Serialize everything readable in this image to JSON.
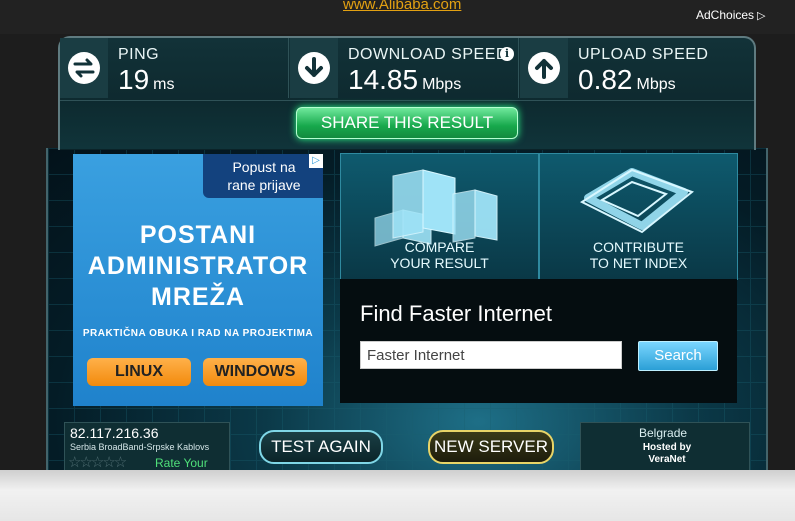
{
  "top": {
    "alibaba_link": "www.Alibaba.com",
    "adchoices": "AdChoices"
  },
  "stats": {
    "ping": {
      "label": "PING",
      "value": "19",
      "unit": "ms"
    },
    "download": {
      "label": "DOWNLOAD SPEED",
      "value": "14.85",
      "unit": "Mbps",
      "info": "i"
    },
    "upload": {
      "label": "UPLOAD SPEED",
      "value": "0.82",
      "unit": "Mbps"
    }
  },
  "share_label": "SHARE THIS RESULT",
  "ad": {
    "badge": "Popust na rane prijave",
    "title_lines": [
      "POSTANI",
      "ADMINISTRATOR",
      "MREŽA"
    ],
    "subtitle": "PRAKTIČNA OBUKA I RAD NA PROJEKTIMA",
    "btn_linux": "LINUX",
    "btn_windows": "WINDOWS"
  },
  "tiles": {
    "compare": {
      "line1": "COMPARE",
      "line2": "YOUR RESULT"
    },
    "contribute": {
      "line1": "CONTRIBUTE",
      "line2": "TO NET INDEX"
    }
  },
  "find": {
    "title": "Find Faster Internet",
    "input_value": "Faster Internet",
    "search_label": "Search"
  },
  "isp": {
    "ip": "82.117.216.36",
    "name": "Serbia BroadBand-Srpske Kablovs",
    "stars": "☆☆☆☆☆",
    "rate_label": "Rate Your ISP",
    "star_rating": 0
  },
  "buttons": {
    "test_again": "TEST AGAIN",
    "new_server": "NEW SERVER"
  },
  "server": {
    "city": "Belgrade",
    "hosted_by": "Hosted by",
    "host": "VeraNet"
  },
  "colors": {
    "share_green": "#17a84c",
    "accent_cyan": "#7fd6e6",
    "alibaba_orange": "#e3a112"
  }
}
